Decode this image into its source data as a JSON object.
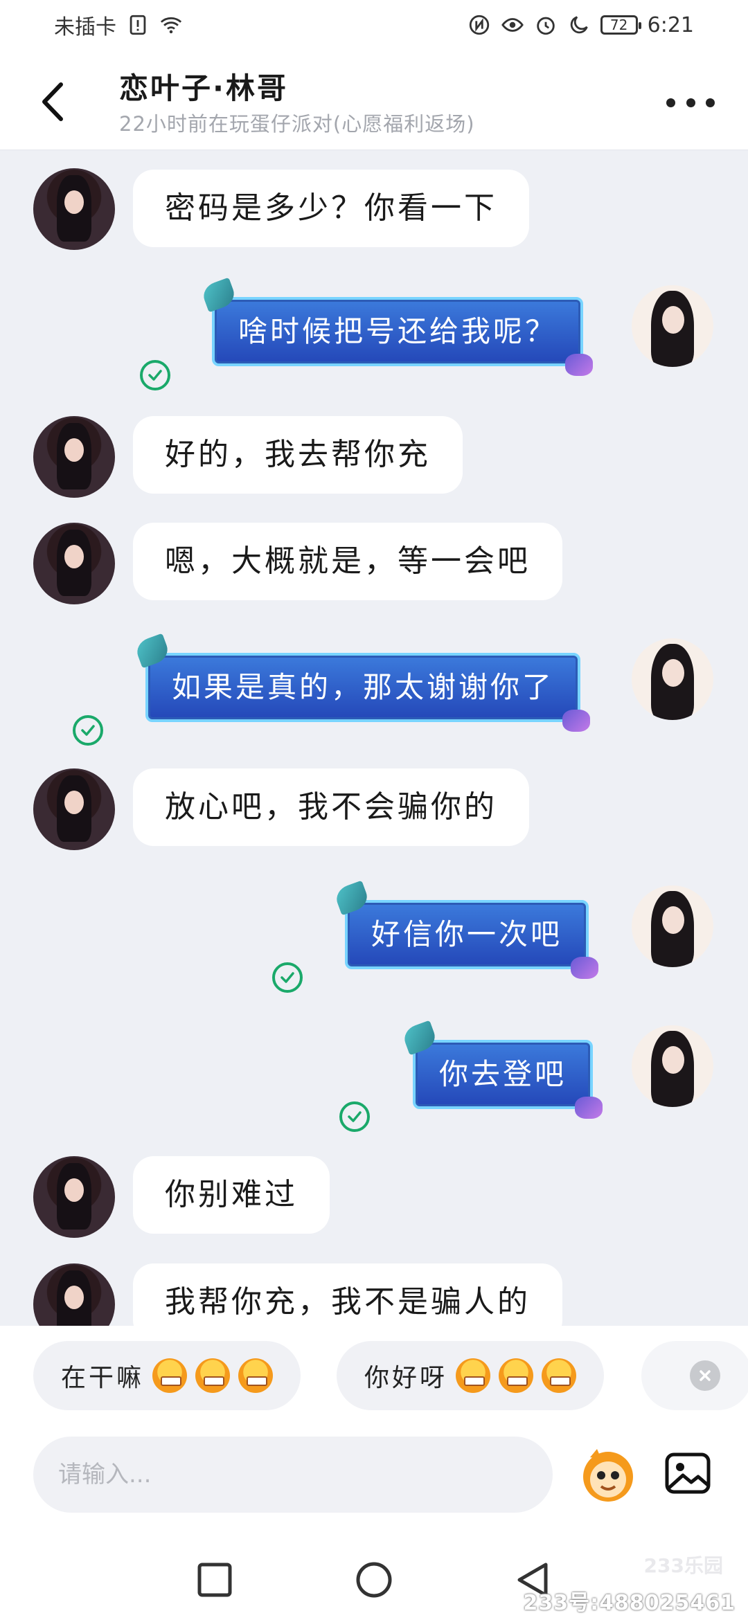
{
  "status_bar": {
    "carrier": "未插卡",
    "battery": "72",
    "time": "6:21"
  },
  "header": {
    "title": "恋叶子·林哥",
    "subtitle": "22小时前在玩蛋仔派对(心愿福利返场)"
  },
  "messages": [
    {
      "from": "other",
      "text": "密码是多少？你看一下"
    },
    {
      "from": "self",
      "text": "啥时候把号还给我呢？",
      "read": true
    },
    {
      "from": "other",
      "text": "好的，我去帮你充"
    },
    {
      "from": "other",
      "text": "嗯，大概就是，等一会吧"
    },
    {
      "from": "self",
      "text": "如果是真的，那太谢谢你了",
      "read": true
    },
    {
      "from": "other",
      "text": "放心吧，我不会骗你的"
    },
    {
      "from": "self",
      "text": "好信你一次吧",
      "read": true
    },
    {
      "from": "self",
      "text": "你去登吧",
      "read": true
    },
    {
      "from": "other",
      "text": "你别难过"
    },
    {
      "from": "other",
      "text": "我帮你充，我不是骗人的"
    }
  ],
  "quick_replies": [
    {
      "text": "在干嘛",
      "emoji": "grin-monkey-emoji"
    },
    {
      "text": "你好呀",
      "emoji": "wow-monkey-emoji"
    }
  ],
  "input": {
    "placeholder": "请输入..."
  },
  "watermark": {
    "logo": "233乐园",
    "id_text": "233号:488025461"
  },
  "colors": {
    "self_bubble": "#2f5fca",
    "self_bubble_border": "#78d4ff",
    "read_check": "#1aa96a",
    "chat_bg": "#eef0f5"
  }
}
